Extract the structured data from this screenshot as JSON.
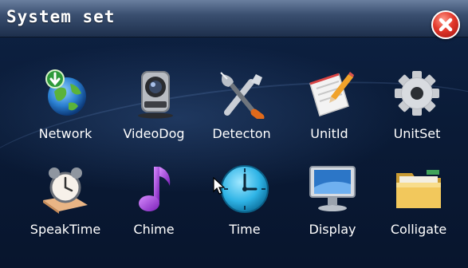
{
  "window": {
    "title": "System set"
  },
  "icons": {
    "row1": [
      {
        "label": "Network",
        "icon": "globe-download-icon"
      },
      {
        "label": "VideoDog",
        "icon": "webcam-icon"
      },
      {
        "label": "Detecton",
        "icon": "tools-icon"
      },
      {
        "label": "UnitId",
        "icon": "notepad-pencil-icon"
      },
      {
        "label": "UnitSet",
        "icon": "gear-icon"
      }
    ],
    "row2": [
      {
        "label": "SpeakTime",
        "icon": "alarm-clock-icon"
      },
      {
        "label": "Chime",
        "icon": "music-note-icon"
      },
      {
        "label": "Time",
        "icon": "clock-icon"
      },
      {
        "label": "Display",
        "icon": "monitor-icon"
      },
      {
        "label": "Colligate",
        "icon": "folder-icon"
      }
    ]
  },
  "colors": {
    "background": "#0a1b37",
    "titlebar": "#3a4f70",
    "close_button": "#e2372a",
    "text": "#ffffff"
  }
}
